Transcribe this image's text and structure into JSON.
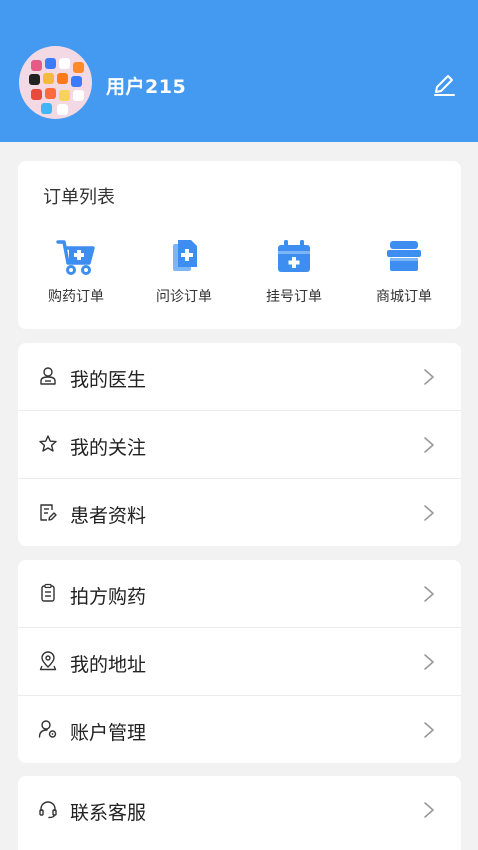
{
  "header": {
    "username": "用户215",
    "bg_color": "#4499f0"
  },
  "orders": {
    "title": "订单列表",
    "items": [
      {
        "label": "购药订单",
        "icon": "shopping-cart-icon"
      },
      {
        "label": "问诊订单",
        "icon": "document-plus-icon"
      },
      {
        "label": "挂号订单",
        "icon": "calendar-plus-icon"
      },
      {
        "label": "商城订单",
        "icon": "store-icon"
      }
    ]
  },
  "menu_group_1": [
    {
      "label": "我的医生",
      "icon": "doctor-icon"
    },
    {
      "label": "我的关注",
      "icon": "star-icon"
    },
    {
      "label": "患者资料",
      "icon": "file-edit-icon"
    }
  ],
  "menu_group_2": [
    {
      "label": "拍方购药",
      "icon": "clipboard-icon"
    },
    {
      "label": "我的地址",
      "icon": "location-icon"
    },
    {
      "label": "账户管理",
      "icon": "user-settings-icon"
    }
  ],
  "menu_group_3": [
    {
      "label": "联系客服",
      "icon": "headset-icon"
    }
  ],
  "colors": {
    "accent": "#4499f0",
    "background": "#f2f2f2"
  }
}
